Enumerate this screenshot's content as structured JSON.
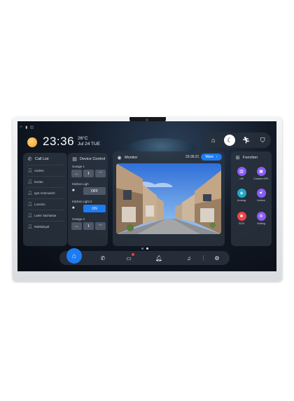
{
  "status": {
    "icons": [
      "wifi-icon",
      "signal-icon",
      "lock-icon"
    ]
  },
  "clock": {
    "time": "23:36"
  },
  "weather": {
    "temperature": "26°C",
    "date": "Jul 24 TUE",
    "icon": "sun-icon"
  },
  "mode_bar": {
    "items": [
      "home-icon",
      "night-mode-icon",
      "away-icon",
      "shield-icon"
    ],
    "active": 1
  },
  "call_list": {
    "title": "Call List",
    "contacts": [
      "Andrés",
      "Dorian",
      "Igor Antonovich",
      "Lorenzo",
      "Lamir Sachaniar",
      "Rakhidzyal"
    ]
  },
  "device_control": {
    "title": "Device Control",
    "garage1": {
      "label": "Garage 1"
    },
    "kitchen_light": {
      "label": "Kitchen Ligh",
      "state": "OFF"
    },
    "kitchen_light2": {
      "label": "Kitchen Light 2",
      "state": "ON"
    },
    "garage2": {
      "label": "Garage 2"
    }
  },
  "monitor": {
    "title": "Monitor",
    "time": "23:36:21",
    "more_label": "More"
  },
  "function": {
    "title": "Function",
    "items": [
      {
        "label": "Lift",
        "color": "#8b5cf6"
      },
      {
        "label": "Custom APK",
        "color": "#8b5cf6"
      },
      {
        "label": "Arming",
        "color": "#22a7c9"
      },
      {
        "label": "Unlock",
        "color": "#8b5cf6"
      },
      {
        "label": "SOS",
        "color": "#ef4444"
      },
      {
        "label": "Setting",
        "color": "#8b5cf6"
      }
    ]
  },
  "pager": {
    "pages": 2,
    "current": 2
  },
  "dock": {
    "items": [
      "home-icon",
      "phone-icon",
      "message-icon",
      "bell-icon",
      "music-icon",
      "settings-icon"
    ]
  },
  "colors": {
    "accent": "#1c7cf2",
    "panel": "#2c3440",
    "background": "#0d131c"
  }
}
